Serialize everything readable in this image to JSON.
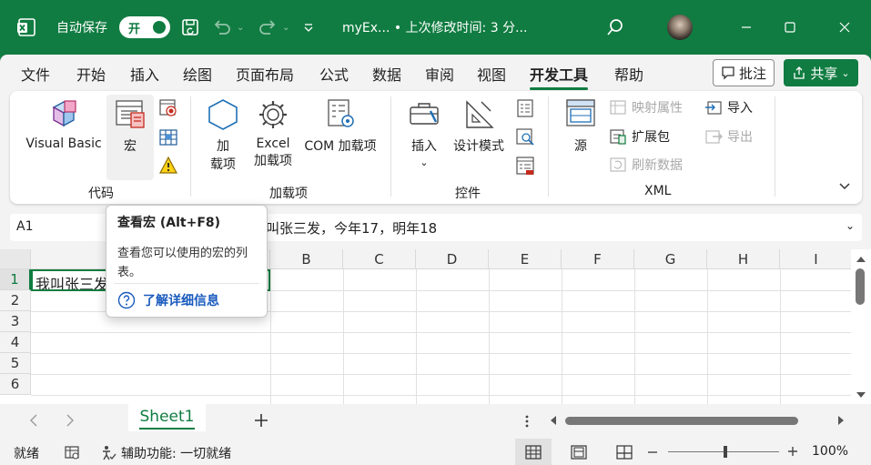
{
  "titlebar": {
    "autosave_label": "自动保存",
    "autosave_toggle": "开",
    "doc_title": "myEx... • 上次修改时间: 3 分..."
  },
  "tabs": [
    "文件",
    "开始",
    "插入",
    "绘图",
    "页面布局",
    "公式",
    "数据",
    "审阅",
    "视图",
    "开发工具",
    "帮助"
  ],
  "active_tab": "开发工具",
  "comment_label": "批注",
  "share_label": "共享",
  "ribbon": {
    "code": {
      "visual_basic": "Visual Basic",
      "macro": "宏",
      "group": "代码"
    },
    "addins": {
      "addins_1": "加",
      "addins_2": "载项",
      "excel_1": "Excel",
      "excel_2": "加载项",
      "com": "COM 加载项",
      "group": "加载项"
    },
    "controls": {
      "insert": "插入",
      "design_mode": "设计模式",
      "group": "控件"
    },
    "xml": {
      "source": "源",
      "map_props": "映射属性",
      "expansion": "扩展包",
      "refresh": "刷新数据",
      "import": "导入",
      "export": "导出",
      "group": "XML"
    }
  },
  "namebox": "A1",
  "formula_text": "叫张三发，今年17，明年18",
  "columns": [
    "B",
    "C",
    "D",
    "E",
    "F",
    "G",
    "H",
    "I"
  ],
  "rows": [
    "1",
    "2",
    "3",
    "4",
    "5",
    "6"
  ],
  "cell_a1": "我叫张三发",
  "tooltip": {
    "title": "查看宏 (Alt+F8)",
    "desc": "查看您可以使用的宏的列表。",
    "link": "了解详细信息"
  },
  "sheet_tab": "Sheet1",
  "status": {
    "ready": "就绪",
    "accessibility": "辅助功能: 一切就绪",
    "zoom": "100%"
  }
}
